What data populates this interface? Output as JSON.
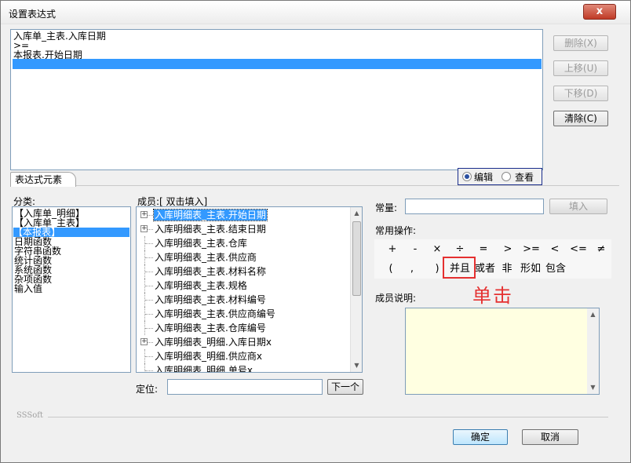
{
  "window": {
    "title": "设置表达式",
    "close_glyph": "x"
  },
  "expression": {
    "lines": [
      "入库单_主表.入库日期",
      ">=",
      "本报表.开始日期",
      ""
    ]
  },
  "right_buttons": {
    "delete": "删除(X)",
    "move_up": "上移(U)",
    "move_down": "下移(D)",
    "clear": "清除(C)"
  },
  "tab": {
    "label": "表达式元素"
  },
  "mode": {
    "edit": "编辑",
    "view": "查看",
    "selected": "编辑"
  },
  "category": {
    "label": "分类:",
    "items": [
      "【入库单_明细】",
      "【入库单_主表】",
      "【本报表】",
      "日期函数",
      "字符串函数",
      "统计函数",
      "系统函数",
      "杂项函数",
      "输入值"
    ],
    "selected_index": 2
  },
  "members": {
    "label": "成员:[ 双击填入]",
    "items": [
      "入库明细表_主表.开始日期",
      "入库明细表_主表.结束日期",
      "入库明细表_主表.仓库",
      "入库明细表_主表.供应商",
      "入库明细表_主表.材料名称",
      "入库明细表_主表.规格",
      "入库明细表_主表.材料编号",
      "入库明细表_主表.供应商编号",
      "入库明细表_主表.仓库编号",
      "入库明细表_明细.入库日期x",
      "入库明细表_明细.供应商x",
      "入库明细表_明细.单号x"
    ],
    "selected_index": 0
  },
  "locate": {
    "label": "定位:",
    "value": "",
    "next_button": "下一个"
  },
  "constant": {
    "label": "常量:",
    "value": "",
    "fill_button": "填入"
  },
  "operations": {
    "label": "常用操作:",
    "row1": [
      "+",
      "-",
      "×",
      "÷",
      "=",
      ">",
      ">=",
      "<",
      "<=",
      "≠"
    ],
    "row2": [
      "(",
      ",",
      ")",
      "并且",
      "或者",
      "非",
      "形如",
      "包含"
    ],
    "highlighted": "并且"
  },
  "annotation": {
    "text": "单击",
    "color": "#e53030"
  },
  "member_desc": {
    "label": "成员说明:",
    "value": ""
  },
  "footer": {
    "brand": "SSSoft",
    "ok": "确定",
    "cancel": "取消"
  },
  "colors": {
    "selection": "#3399ff",
    "desc_background": "#ffffe1",
    "close_button": "#c03a26"
  }
}
